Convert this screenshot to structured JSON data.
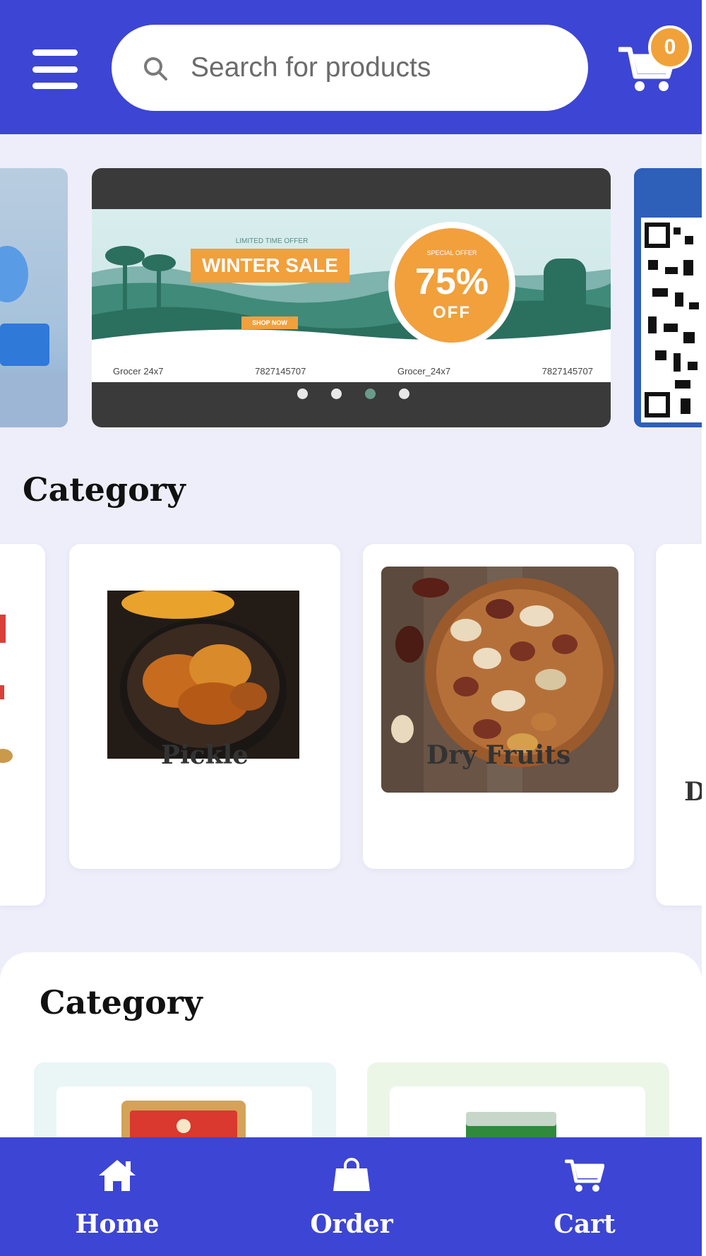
{
  "header": {
    "menu_icon": "hamburger-menu-icon",
    "search": {
      "placeholder": "Search for products",
      "value": "",
      "icon": "search-icon"
    },
    "cart": {
      "icon": "cart-icon",
      "count": "0"
    }
  },
  "banner": {
    "limited_text": "LIMITED TIME OFFER",
    "sale_title": "WINTER SALE",
    "shop_now": "SHOP NOW",
    "offer_small": "SPECIAL OFFER",
    "offer_percent": "75%",
    "offer_off": "OFF",
    "contacts": [
      "Grocer 24x7",
      "7827145707",
      "Grocer_24x7",
      "7827145707"
    ],
    "dot_count": 4,
    "active_dot": 3
  },
  "category_section": {
    "title": "Category",
    "items": [
      {
        "label": "Pickle"
      },
      {
        "label": "Dry Fruits"
      }
    ],
    "next_partial_label": "D"
  },
  "category_section_2": {
    "title": "Category"
  },
  "bottom_nav": [
    {
      "label": "Home",
      "icon": "home-icon"
    },
    {
      "label": "Order",
      "icon": "shopping-bag-icon"
    },
    {
      "label": "Cart",
      "icon": "cart-icon"
    }
  ],
  "colors": {
    "primary": "#3d45d4",
    "badge": "#f1a139",
    "background": "#eeeefa"
  }
}
